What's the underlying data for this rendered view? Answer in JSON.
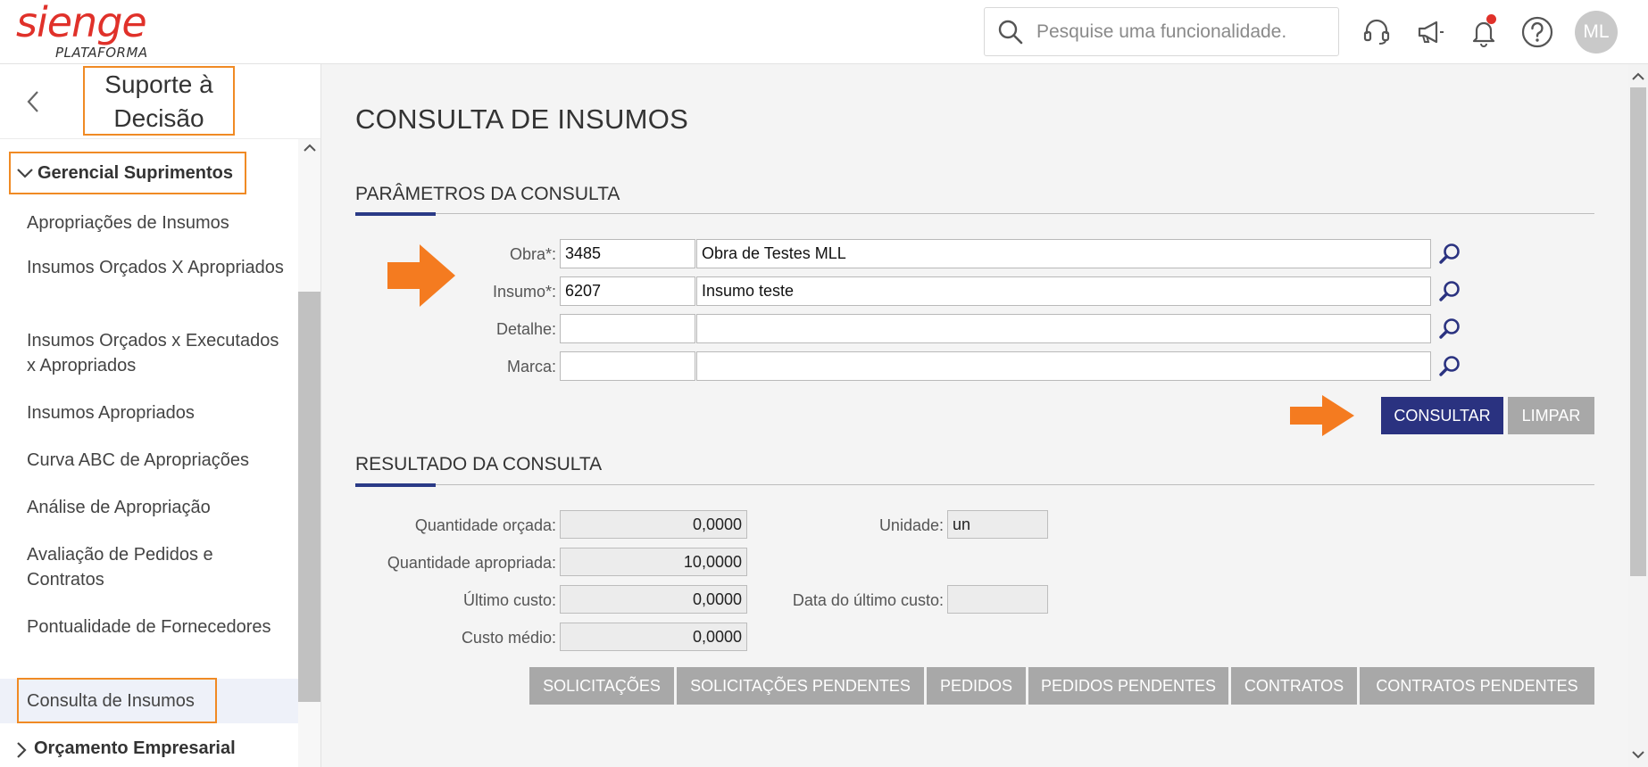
{
  "brand": {
    "logo_text": "sienge",
    "logo_subtext": "PLATAFORMA"
  },
  "search": {
    "placeholder": "Pesquise uma funcionalidade."
  },
  "user": {
    "initials": "ML"
  },
  "sidebar": {
    "title": "Suporte à Decisão",
    "group": "Gerencial Suprimentos",
    "items": [
      {
        "label": "Apropriações de Insumos"
      },
      {
        "label": "Insumos Orçados X Apropriados"
      },
      {
        "label": "Insumos Orçados x Executados x Apropriados"
      },
      {
        "label": "Insumos Apropriados"
      },
      {
        "label": "Curva ABC de Apropriações"
      },
      {
        "label": "Análise de Apropriação"
      },
      {
        "label": "Avaliação de Pedidos e Contratos"
      },
      {
        "label": "Pontualidade de Fornecedores"
      },
      {
        "label": "Consulta de Insumos"
      }
    ],
    "next_group": "Orçamento Empresarial"
  },
  "page": {
    "title": "CONSULTA DE INSUMOS",
    "params_title": "PARÂMETROS DA CONSULTA",
    "result_title": "RESULTADO DA CONSULTA"
  },
  "params": {
    "obra": {
      "label": "Obra*:",
      "code": "3485",
      "desc": "Obra de Testes MLL"
    },
    "insumo": {
      "label": "Insumo*:",
      "code": "6207",
      "desc": "Insumo teste"
    },
    "detalhe": {
      "label": "Detalhe:",
      "code": "",
      "desc": ""
    },
    "marca": {
      "label": "Marca:",
      "code": "",
      "desc": ""
    }
  },
  "actions": {
    "consultar": "CONSULTAR",
    "limpar": "LIMPAR"
  },
  "result": {
    "qtd_orcada": {
      "label": "Quantidade orçada:",
      "value": "0,0000"
    },
    "qtd_apropriada": {
      "label": "Quantidade apropriada:",
      "value": "10,0000"
    },
    "ultimo_custo": {
      "label": "Último custo:",
      "value": "0,0000"
    },
    "custo_medio": {
      "label": "Custo médio:",
      "value": "0,0000"
    },
    "unidade": {
      "label": "Unidade:",
      "value": "un"
    },
    "data_ultimo_custo": {
      "label": "Data do último custo:",
      "value": ""
    }
  },
  "bottom_buttons": {
    "solicitacoes": "SOLICITAÇÕES",
    "solicitacoes_pendentes": "SOLICITAÇÕES PENDENTES",
    "pedidos": "PEDIDOS",
    "pedidos_pendentes": "PEDIDOS PENDENTES",
    "contratos": "CONTRATOS",
    "contratos_pendentes": "CONTRATOS PENDENTES"
  },
  "colors": {
    "brand_red": "#e0312a",
    "primary": "#2a3280",
    "highlight_orange": "#f08a24",
    "arrow_orange": "#f47b20"
  },
  "icons": [
    "search-icon",
    "headset-icon",
    "megaphone-icon",
    "bell-icon",
    "help-icon",
    "chevron-left-icon",
    "chevron-down-icon",
    "chevron-right-icon",
    "magnifier-icon",
    "arrow-right-icon"
  ]
}
